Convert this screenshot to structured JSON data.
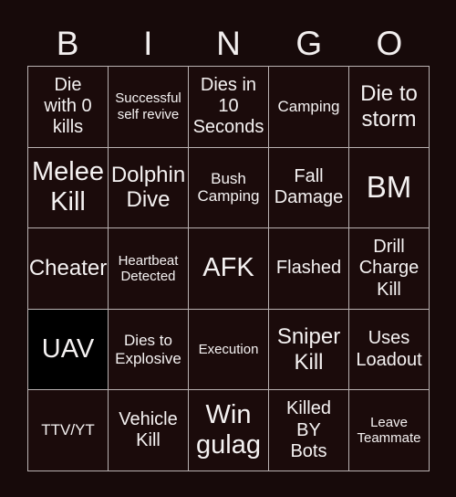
{
  "header": {
    "letters": [
      "B",
      "I",
      "N",
      "G",
      "O"
    ]
  },
  "colors": {
    "background": "#170a0a",
    "cell_background": "#1b0b0b",
    "marked_background": "#000000",
    "border": "#b9b2b2",
    "text": "#f5f2f2"
  },
  "grid": {
    "columns": 5,
    "rows": 5,
    "cells": [
      {
        "text": "Die\nwith 0\nkills",
        "size": "lg",
        "marked": false
      },
      {
        "text": "Successful\nself revive",
        "size": "sm",
        "marked": false
      },
      {
        "text": "Dies in\n10\nSeconds",
        "size": "lg",
        "marked": false
      },
      {
        "text": "Camping",
        "size": "md",
        "marked": false
      },
      {
        "text": "Die to\nstorm",
        "size": "xl",
        "marked": false
      },
      {
        "text": "Melee\nKill",
        "size": "xxl",
        "marked": false
      },
      {
        "text": "Dolphin\nDive",
        "size": "xl",
        "marked": false
      },
      {
        "text": "Bush\nCamping",
        "size": "md",
        "marked": false
      },
      {
        "text": "Fall\nDamage",
        "size": "lg",
        "marked": false
      },
      {
        "text": "BM",
        "size": "huge",
        "marked": false
      },
      {
        "text": "Cheater",
        "size": "xl",
        "marked": false
      },
      {
        "text": "Heartbeat\nDetected",
        "size": "sm",
        "marked": false
      },
      {
        "text": "AFK",
        "size": "xxl",
        "marked": false
      },
      {
        "text": "Flashed",
        "size": "lg",
        "marked": false
      },
      {
        "text": "Drill\nCharge\nKill",
        "size": "lg",
        "marked": false
      },
      {
        "text": "UAV",
        "size": "xxl",
        "marked": true
      },
      {
        "text": "Dies to\nExplosive",
        "size": "md",
        "marked": false
      },
      {
        "text": "Execution",
        "size": "sm",
        "marked": false
      },
      {
        "text": "Sniper\nKill",
        "size": "xl",
        "marked": false
      },
      {
        "text": "Uses\nLoadout",
        "size": "lg",
        "marked": false
      },
      {
        "text": "TTV/YT",
        "size": "md",
        "marked": false
      },
      {
        "text": "Vehicle\nKill",
        "size": "lg",
        "marked": false
      },
      {
        "text": "Win\ngulag",
        "size": "xxl",
        "marked": false
      },
      {
        "text": "Killed\nBY\nBots",
        "size": "lg",
        "marked": false
      },
      {
        "text": "Leave\nTeammate",
        "size": "sm",
        "marked": false
      }
    ]
  }
}
